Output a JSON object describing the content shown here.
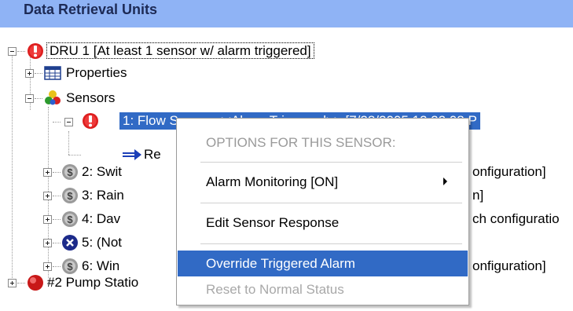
{
  "header": {
    "title": "Data Retrieval Units"
  },
  "tree": {
    "dru1": {
      "label": "DRU 1  [At least 1 sensor w/ alarm triggered]"
    },
    "properties": {
      "label": "Properties"
    },
    "sensors": {
      "label": "Sensors"
    },
    "sensor1": {
      "label": "1: Flow Sensor  <<Alarm Triggered>>  [7/28/2005 12:22:08 P"
    },
    "response": {
      "label": "Re"
    },
    "sensor2": {
      "label": "2: Swit",
      "tail": "onfiguration]"
    },
    "sensor3": {
      "label": "3: Rain",
      "tail": "n]"
    },
    "sensor4": {
      "label": "4: Dav",
      "tail": "ch configuratio"
    },
    "sensor5": {
      "label": "5: (Not"
    },
    "sensor6": {
      "label": "6: Win",
      "tail": "onfiguration]"
    },
    "pump": {
      "label": "#2 Pump Statio"
    }
  },
  "context_menu": {
    "header": "OPTIONS FOR THIS SENSOR:",
    "alarm_monitoring": "Alarm Monitoring [ON]",
    "edit_response": "Edit Sensor Response",
    "override_alarm": "Override Triggered Alarm",
    "reset_status": "Reset to Normal Status"
  },
  "icons": {
    "alarm": "exclamation-alarm-icon",
    "properties": "properties-grid-icon",
    "sensors": "sensors-cluster-icon",
    "response": "arrow-right-icon",
    "sensor": "sensor-coil-icon",
    "error": "x-circle-icon",
    "station": "red-ball-icon"
  },
  "colors": {
    "header_bg": "#8fb3f5",
    "selection": "#316ac5",
    "alarm_red": "#dd1f1f"
  }
}
